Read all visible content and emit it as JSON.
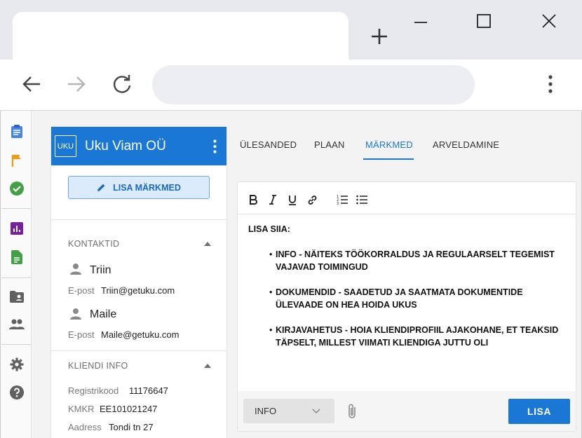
{
  "browser": {
    "icons": [
      "plus-icon",
      "minimize-icon",
      "maximize-icon",
      "close-icon",
      "back-icon",
      "forward-icon",
      "reload-icon",
      "more-vert-icon"
    ]
  },
  "rail": {
    "items": [
      "tasks-icon",
      "flag-icon",
      "check-icon",
      "chart-icon",
      "document-icon",
      "contacts-folder-icon",
      "people-icon",
      "settings-icon",
      "help-icon"
    ]
  },
  "panel": {
    "logo": "UKU",
    "company": "Uku Viam OÜ",
    "add_note_label": "LISA MÄRKMED",
    "contacts_title": "KONTAKTID",
    "contacts": [
      {
        "name": "Triin",
        "email_label": "E-post",
        "email": "Triin@getuku.com"
      },
      {
        "name": "Maile",
        "email_label": "E-post",
        "email": "Maile@getuku.com"
      }
    ],
    "client_info_title": "KLIENDI INFO",
    "client_info": [
      {
        "label": "Registrikood",
        "value": "11176647"
      },
      {
        "label": "KMKR",
        "value": "EE101021247"
      },
      {
        "label": "Aadress",
        "value": "Tondi tn 27"
      }
    ]
  },
  "tabs": [
    {
      "label": "ÜLESANDED"
    },
    {
      "label": "PLAAN"
    },
    {
      "label": "MÄRKMED",
      "active": true
    },
    {
      "label": "ARVELDAMINE"
    }
  ],
  "editor": {
    "heading": "LISA SIIA:",
    "bullets": [
      "INFO - NÄITEKS TÖÖKORRALDUS JA REGULAARSELT TEGEMIST VAJAVAD TOIMINGUD",
      "DOKUMENDID - SAADETUD JA SAATMATA DOKUMENTIDE ÜLEVAADE ON HEA HOIDA UKUS",
      "KIRJAVAHETUS - HOIA KLIENDIPROFIIL AJAKOHANE, ET TEAKSID TÄPSELT, MILLEST VIIMATI KLIENDIGA JUTTU OLI"
    ],
    "type_value": "INFO",
    "submit_label": "LISA"
  },
  "colors": {
    "accent": "#1a78d4",
    "chrome_bg": "#e8e9ec"
  }
}
